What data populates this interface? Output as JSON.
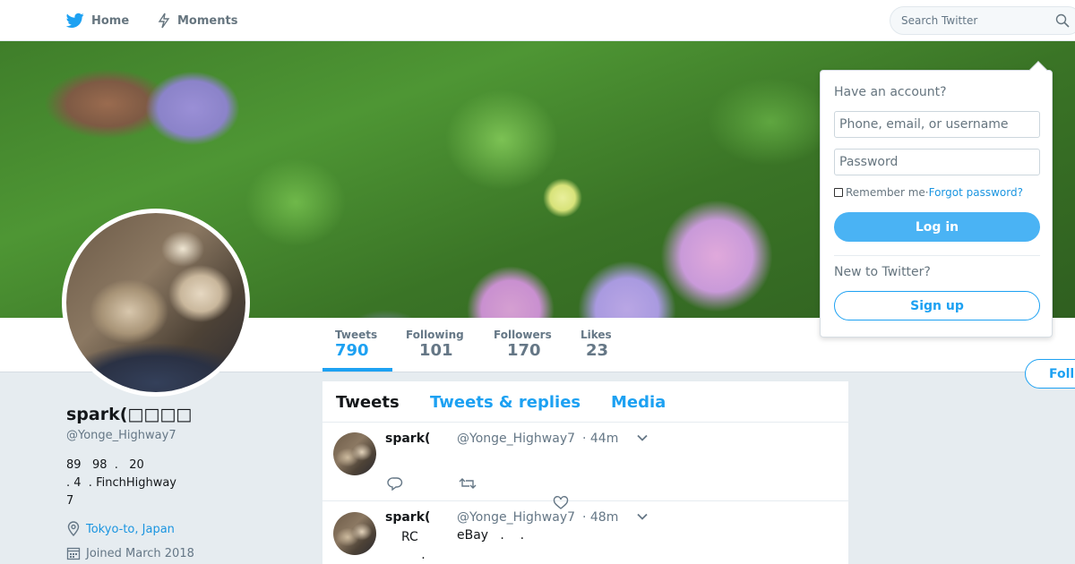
{
  "nav": {
    "home_label": "Home",
    "moments_label": "Moments",
    "search_placeholder": "Search Twitter"
  },
  "profile": {
    "name": "spark(□□□□",
    "handle": "@Yonge_Highway7",
    "bio_line1": "89   98  .   20",
    "bio_line2": ". 4  . FinchHighway",
    "bio_line3": "7",
    "location": "Tokyo-to, Japan",
    "joined": "Joined March 2018"
  },
  "stats": [
    {
      "label": "Tweets",
      "value": "790"
    },
    {
      "label": "Following",
      "value": "101"
    },
    {
      "label": "Followers",
      "value": "170"
    },
    {
      "label": "Likes",
      "value": "23"
    }
  ],
  "follow_label": "Follow",
  "timeline": {
    "tabs": [
      "Tweets",
      "Tweets & replies",
      "Media"
    ],
    "tweets": [
      {
        "name": "spark(",
        "handle": "@Yonge_Highway7",
        "time": "· 44m",
        "text": ""
      },
      {
        "name": "spark(",
        "handle": "@Yonge_Highway7",
        "time": "· 48m",
        "text_left": "RC\n     .",
        "text_right": "eBay   .    ."
      }
    ]
  },
  "login": {
    "heading": "Have an account?",
    "username_placeholder": "Phone, email, or username",
    "password_placeholder": "Password",
    "remember": "Remember me",
    "separator": " · ",
    "forgot": "Forgot password?",
    "login_label": "Log in",
    "new_text": "New to Twitter?",
    "signup_label": "Sign up"
  },
  "colors": {
    "accent": "#1da1f2",
    "background": "#e6ecf0",
    "login_button": "#4ab3f4"
  }
}
